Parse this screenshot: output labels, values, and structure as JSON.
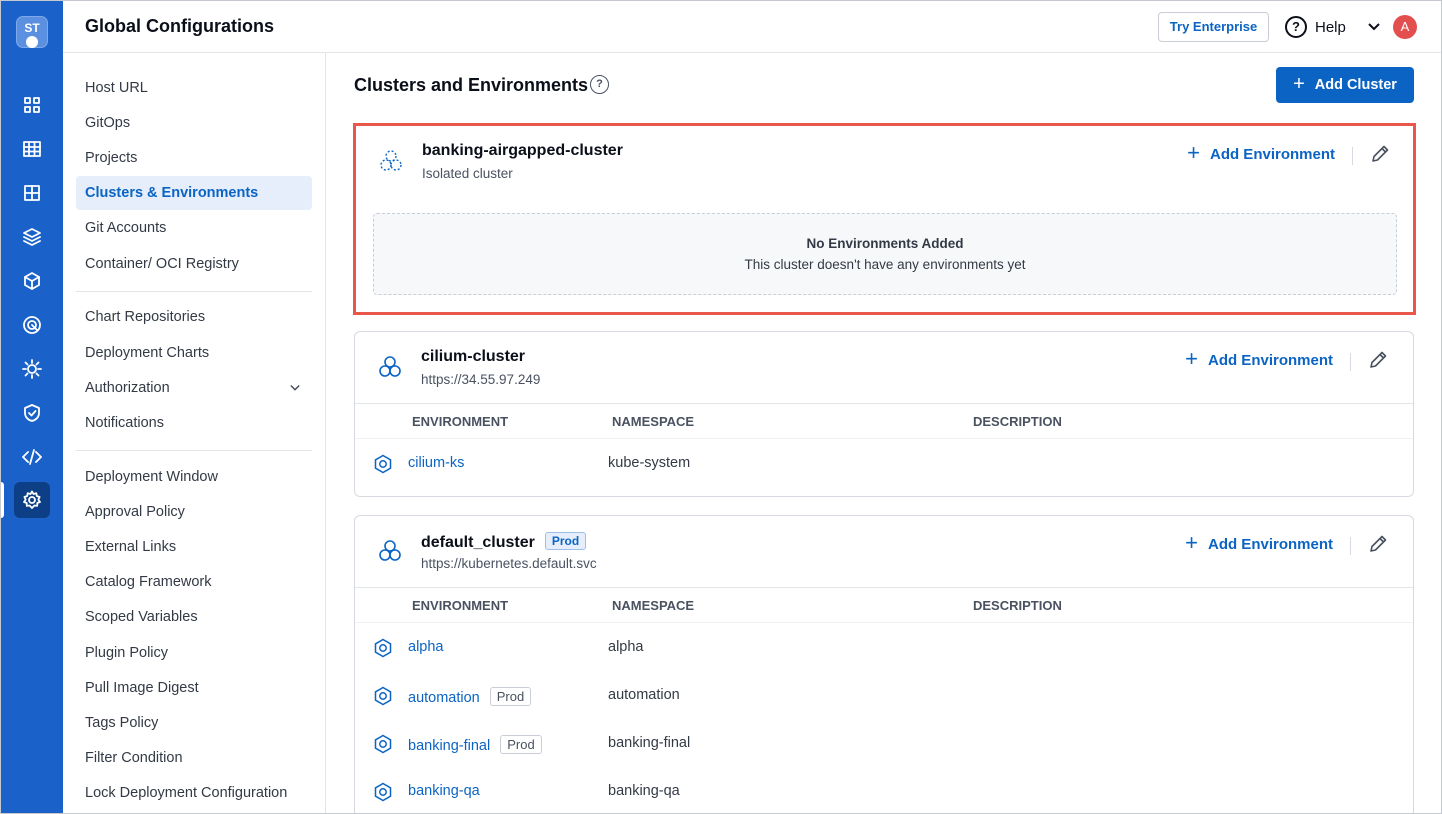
{
  "app": {
    "logo_text": "ST"
  },
  "header": {
    "title": "Global Configurations",
    "try_enterprise": "Try Enterprise",
    "help_label": "Help",
    "avatar_initial": "A"
  },
  "rail": {
    "icons": [
      "grid-icon",
      "table-icon",
      "dashboard-icon",
      "layers-icon",
      "cube-icon",
      "target-icon",
      "bug-icon",
      "shield-icon",
      "code-icon",
      "gear-icon"
    ],
    "active": "gear-icon"
  },
  "sidebar": {
    "items": [
      "Host URL",
      "GitOps",
      "Projects",
      "Clusters & Environments",
      "Git Accounts",
      "Container/ OCI Registry",
      "Chart Repositories",
      "Deployment Charts",
      "Authorization",
      "Notifications",
      "Deployment Window",
      "Approval Policy",
      "External Links",
      "Catalog Framework",
      "Scoped Variables",
      "Plugin Policy",
      "Pull Image Digest",
      "Tags Policy",
      "Filter Condition",
      "Lock Deployment Configuration"
    ],
    "active": "Clusters & Environments"
  },
  "main": {
    "title": "Clusters and Environments",
    "add_cluster": "Add Cluster",
    "add_environment": "Add Environment",
    "columns": {
      "environment": "ENVIRONMENT",
      "namespace": "NAMESPACE",
      "description": "DESCRIPTION"
    },
    "clusters": [
      {
        "name": "banking-airgapped-cluster",
        "subtitle": "Isolated cluster",
        "empty_title": "No Environments Added",
        "empty_text": "This cluster doesn't have any environments yet"
      },
      {
        "name": "cilium-cluster",
        "subtitle": "https://34.55.97.249",
        "environments": [
          {
            "name": "cilium-ks",
            "namespace": "kube-system"
          }
        ]
      },
      {
        "name": "default_cluster",
        "badge": "Prod",
        "subtitle": "https://kubernetes.default.svc",
        "environments": [
          {
            "name": "alpha",
            "namespace": "alpha"
          },
          {
            "name": "automation",
            "tag": "Prod",
            "namespace": "automation"
          },
          {
            "name": "banking-final",
            "tag": "Prod",
            "namespace": "banking-final"
          },
          {
            "name": "banking-qa",
            "namespace": "banking-qa"
          }
        ]
      }
    ]
  },
  "colors": {
    "primary": "#0b64c4",
    "rail": "#1a62c9",
    "highlight": "#e8574a"
  }
}
